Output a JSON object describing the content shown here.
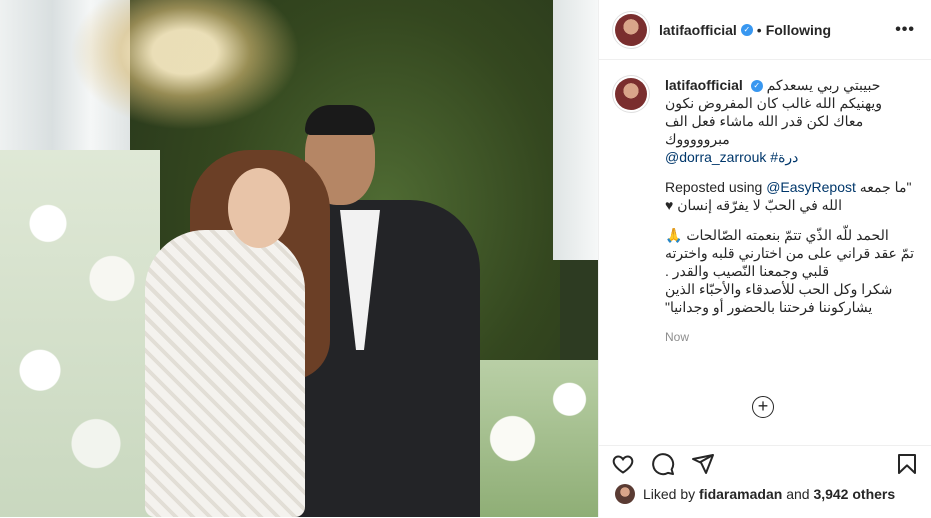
{
  "post": {
    "username": "latifaofficial",
    "verified_badge": "verified-icon",
    "dot": "•",
    "follow_status": "Following",
    "more_label": "•••"
  },
  "caption": {
    "username": "latifaofficial",
    "line1": "حبيبتي ربي يسعدكم",
    "line2": "ويهنيكم الله غالب كان المفروض نكون",
    "line3": "معاك لكن قدر الله ماشاء فعل الف",
    "line4": "مبروووووك",
    "hashtag": "#درة",
    "mention": "@dorra_zarrouk",
    "repost_prefix": "Reposted using",
    "repost_handle": "@EasyRepost",
    "repost_quote": "\"ما جمعه",
    "line5": "الله في الحبّ لا يفرّقه إنسان ♥",
    "line6": "الحمد للّه الذّي تتمّ بنعمته الصّالحات 🙏",
    "line7": "تمّ عقد قراني على من اختارني قلبه واخترته",
    "line8": "قلبي وجمعنا النّصيب والقدر .",
    "line9": "شكرا وكل الحب للأصدقاء والأحبّاء الذين",
    "line10": "يشاركوننا فرحتنا بالحضور أو وجدانيا\"",
    "timestamp": "Now",
    "add_comment_symbol": "+"
  },
  "actions": {
    "icons": [
      "heart-icon",
      "comment-icon",
      "share-icon",
      "bookmark-icon"
    ]
  },
  "likes": {
    "prefix": "Liked by",
    "user": "fidaramadan",
    "and": "and",
    "count": "3,942 others"
  },
  "colors": {
    "link": "#00376b",
    "verified": "#3897f0",
    "muted": "#8e8e8e",
    "border": "#efefef"
  }
}
